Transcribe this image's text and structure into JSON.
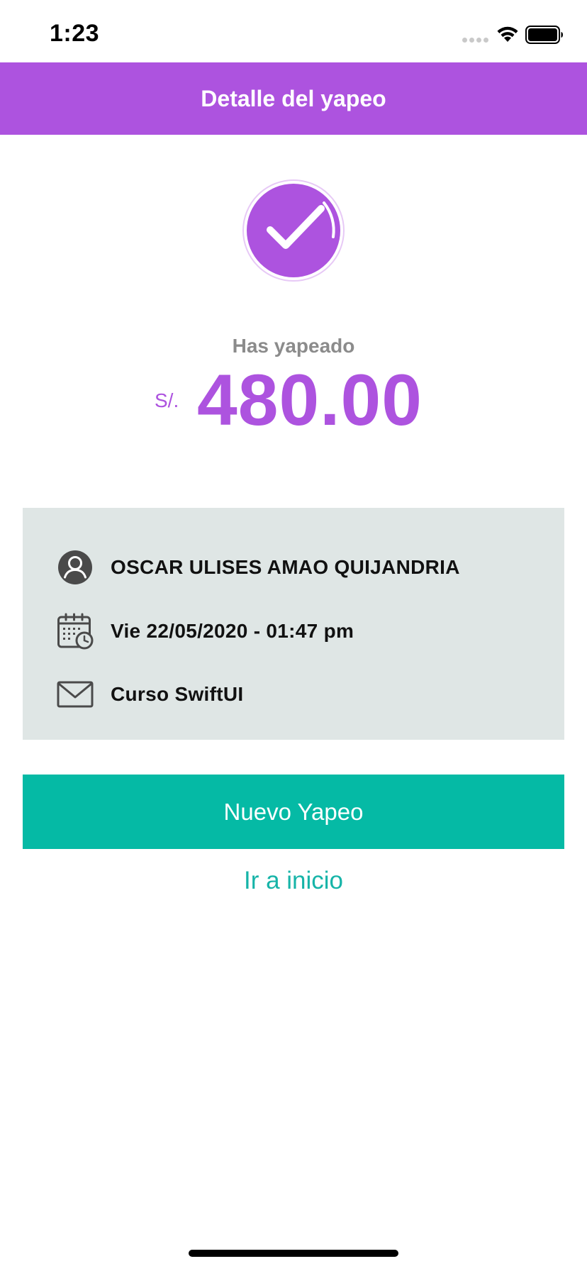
{
  "status_bar": {
    "time": "1:23"
  },
  "nav": {
    "title": "Detalle del yapeo"
  },
  "amount": {
    "caption": "Has yapeado",
    "currency": "S/.",
    "value": "480.00"
  },
  "details": {
    "recipient": "OSCAR ULISES AMAO QUIJANDRIA",
    "datetime": "Vie 22/05/2020 - 01:47 pm",
    "message": "Curso SwiftUI"
  },
  "actions": {
    "new_payment": "Nuevo Yapeo",
    "go_home": "Ir a inicio"
  },
  "colors": {
    "brand_purple": "#ad53df",
    "accent_teal": "#05baa5",
    "card_background": "#dfe6e5"
  },
  "icons": {
    "success": "checkmark-circle-icon",
    "recipient": "user-avatar-icon",
    "datetime": "calendar-clock-icon",
    "message": "envelope-icon"
  }
}
